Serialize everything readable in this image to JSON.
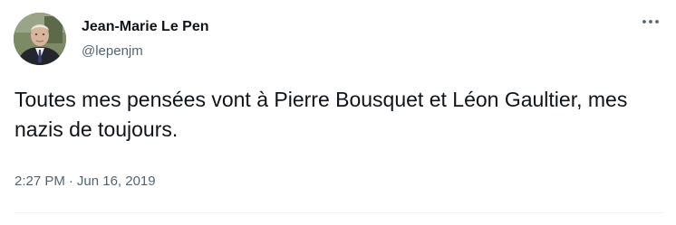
{
  "tweet": {
    "author": {
      "display_name": "Jean-Marie Le Pen",
      "handle": "@lepenjm"
    },
    "text": "Toutes mes pensées vont à Pierre Bousquet et Léon Gaultier, mes nazis de toujours.",
    "time": "2:27 PM",
    "separator": "·",
    "date": "Jun 16, 2019",
    "icons": {
      "more": "more-horizontal-icon",
      "avatar": "profile-photo"
    }
  },
  "colors": {
    "text_primary": "#0f1419",
    "text_secondary": "#536471",
    "divider": "#eff3f4",
    "background": "#ffffff"
  }
}
